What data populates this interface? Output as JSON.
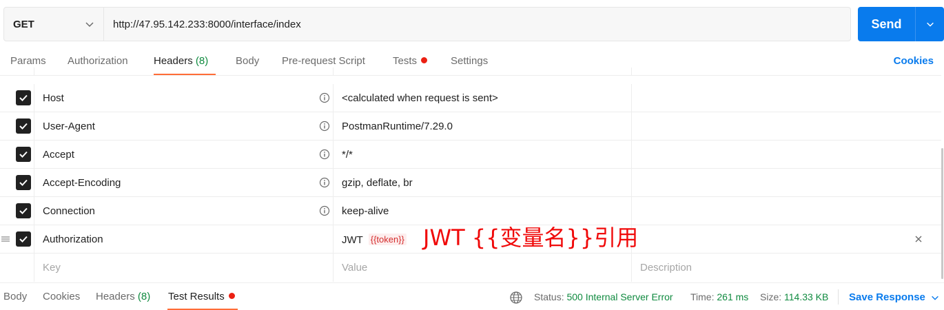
{
  "request": {
    "method": "GET",
    "url": "http://47.95.142.233:8000/interface/index",
    "send_label": "Send"
  },
  "req_tabs": {
    "params": "Params",
    "authorization": "Authorization",
    "headers": "Headers",
    "headers_count": "(8)",
    "body": "Body",
    "pre_request": "Pre-request Script",
    "tests": "Tests",
    "settings": "Settings",
    "cookies": "Cookies"
  },
  "headers": [
    {
      "key": "Host",
      "value": "<calculated when request is sent>",
      "checked": true
    },
    {
      "key": "User-Agent",
      "value": "PostmanRuntime/7.29.0",
      "checked": true
    },
    {
      "key": "Accept",
      "value": "*/*",
      "checked": true
    },
    {
      "key": "Accept-Encoding",
      "value": "gzip, deflate, br",
      "checked": true
    },
    {
      "key": "Connection",
      "value": "keep-alive",
      "checked": true
    },
    {
      "key": "Authorization",
      "value_prefix": "JWT",
      "value_var": "{{token}}",
      "checked": true
    }
  ],
  "new_row": {
    "key_placeholder": "Key",
    "value_placeholder": "Value",
    "description_placeholder": "Description"
  },
  "annotation": "JWT {{变量名}}引用",
  "response": {
    "tabs": {
      "body": "Body",
      "cookies": "Cookies",
      "headers": "Headers",
      "headers_count": "(8)",
      "test_results": "Test Results"
    },
    "status_label": "Status:",
    "status_value": "500 Internal Server Error",
    "time_label": "Time:",
    "time_value": "261 ms",
    "size_label": "Size:",
    "size_value": "114.33 KB",
    "save_response": "Save Response"
  },
  "colors": {
    "accent": "#097bed",
    "tab_underline": "#ff6c37",
    "success": "#0f8a3f",
    "indicator_dot": "#eb2013",
    "annotation": "#f00a0a"
  }
}
